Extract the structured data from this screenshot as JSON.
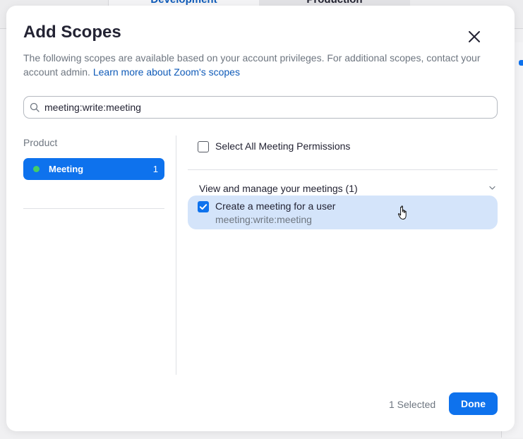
{
  "background": {
    "tabs": [
      {
        "label": "Development"
      },
      {
        "label": "Production"
      }
    ]
  },
  "modal": {
    "title": "Add Scopes",
    "description": "The following scopes are available based on your account privileges. For additional scopes, contact your account admin.",
    "learn_more_link": "Learn more about Zoom's scopes",
    "search": {
      "value": "meeting:write:meeting",
      "icon": "search-icon"
    },
    "product_heading": "Product",
    "products": [
      {
        "name": "Meeting",
        "count": "1",
        "status_color": "#44cc66",
        "selected": true
      }
    ],
    "select_all_label": "Select All Meeting Permissions",
    "groups": [
      {
        "header": "View and manage your meetings (1)",
        "expanded": true,
        "scopes": [
          {
            "title": "Create a meeting for a user",
            "scope": "meeting:write:meeting",
            "checked": true
          }
        ]
      }
    ],
    "footer": {
      "selected_count": "1 Selected",
      "done_label": "Done"
    }
  },
  "colors": {
    "accent": "#0e72ed",
    "link": "#0e5ab8",
    "highlight_row": "#d4e4fa",
    "status_green": "#44cc66"
  }
}
